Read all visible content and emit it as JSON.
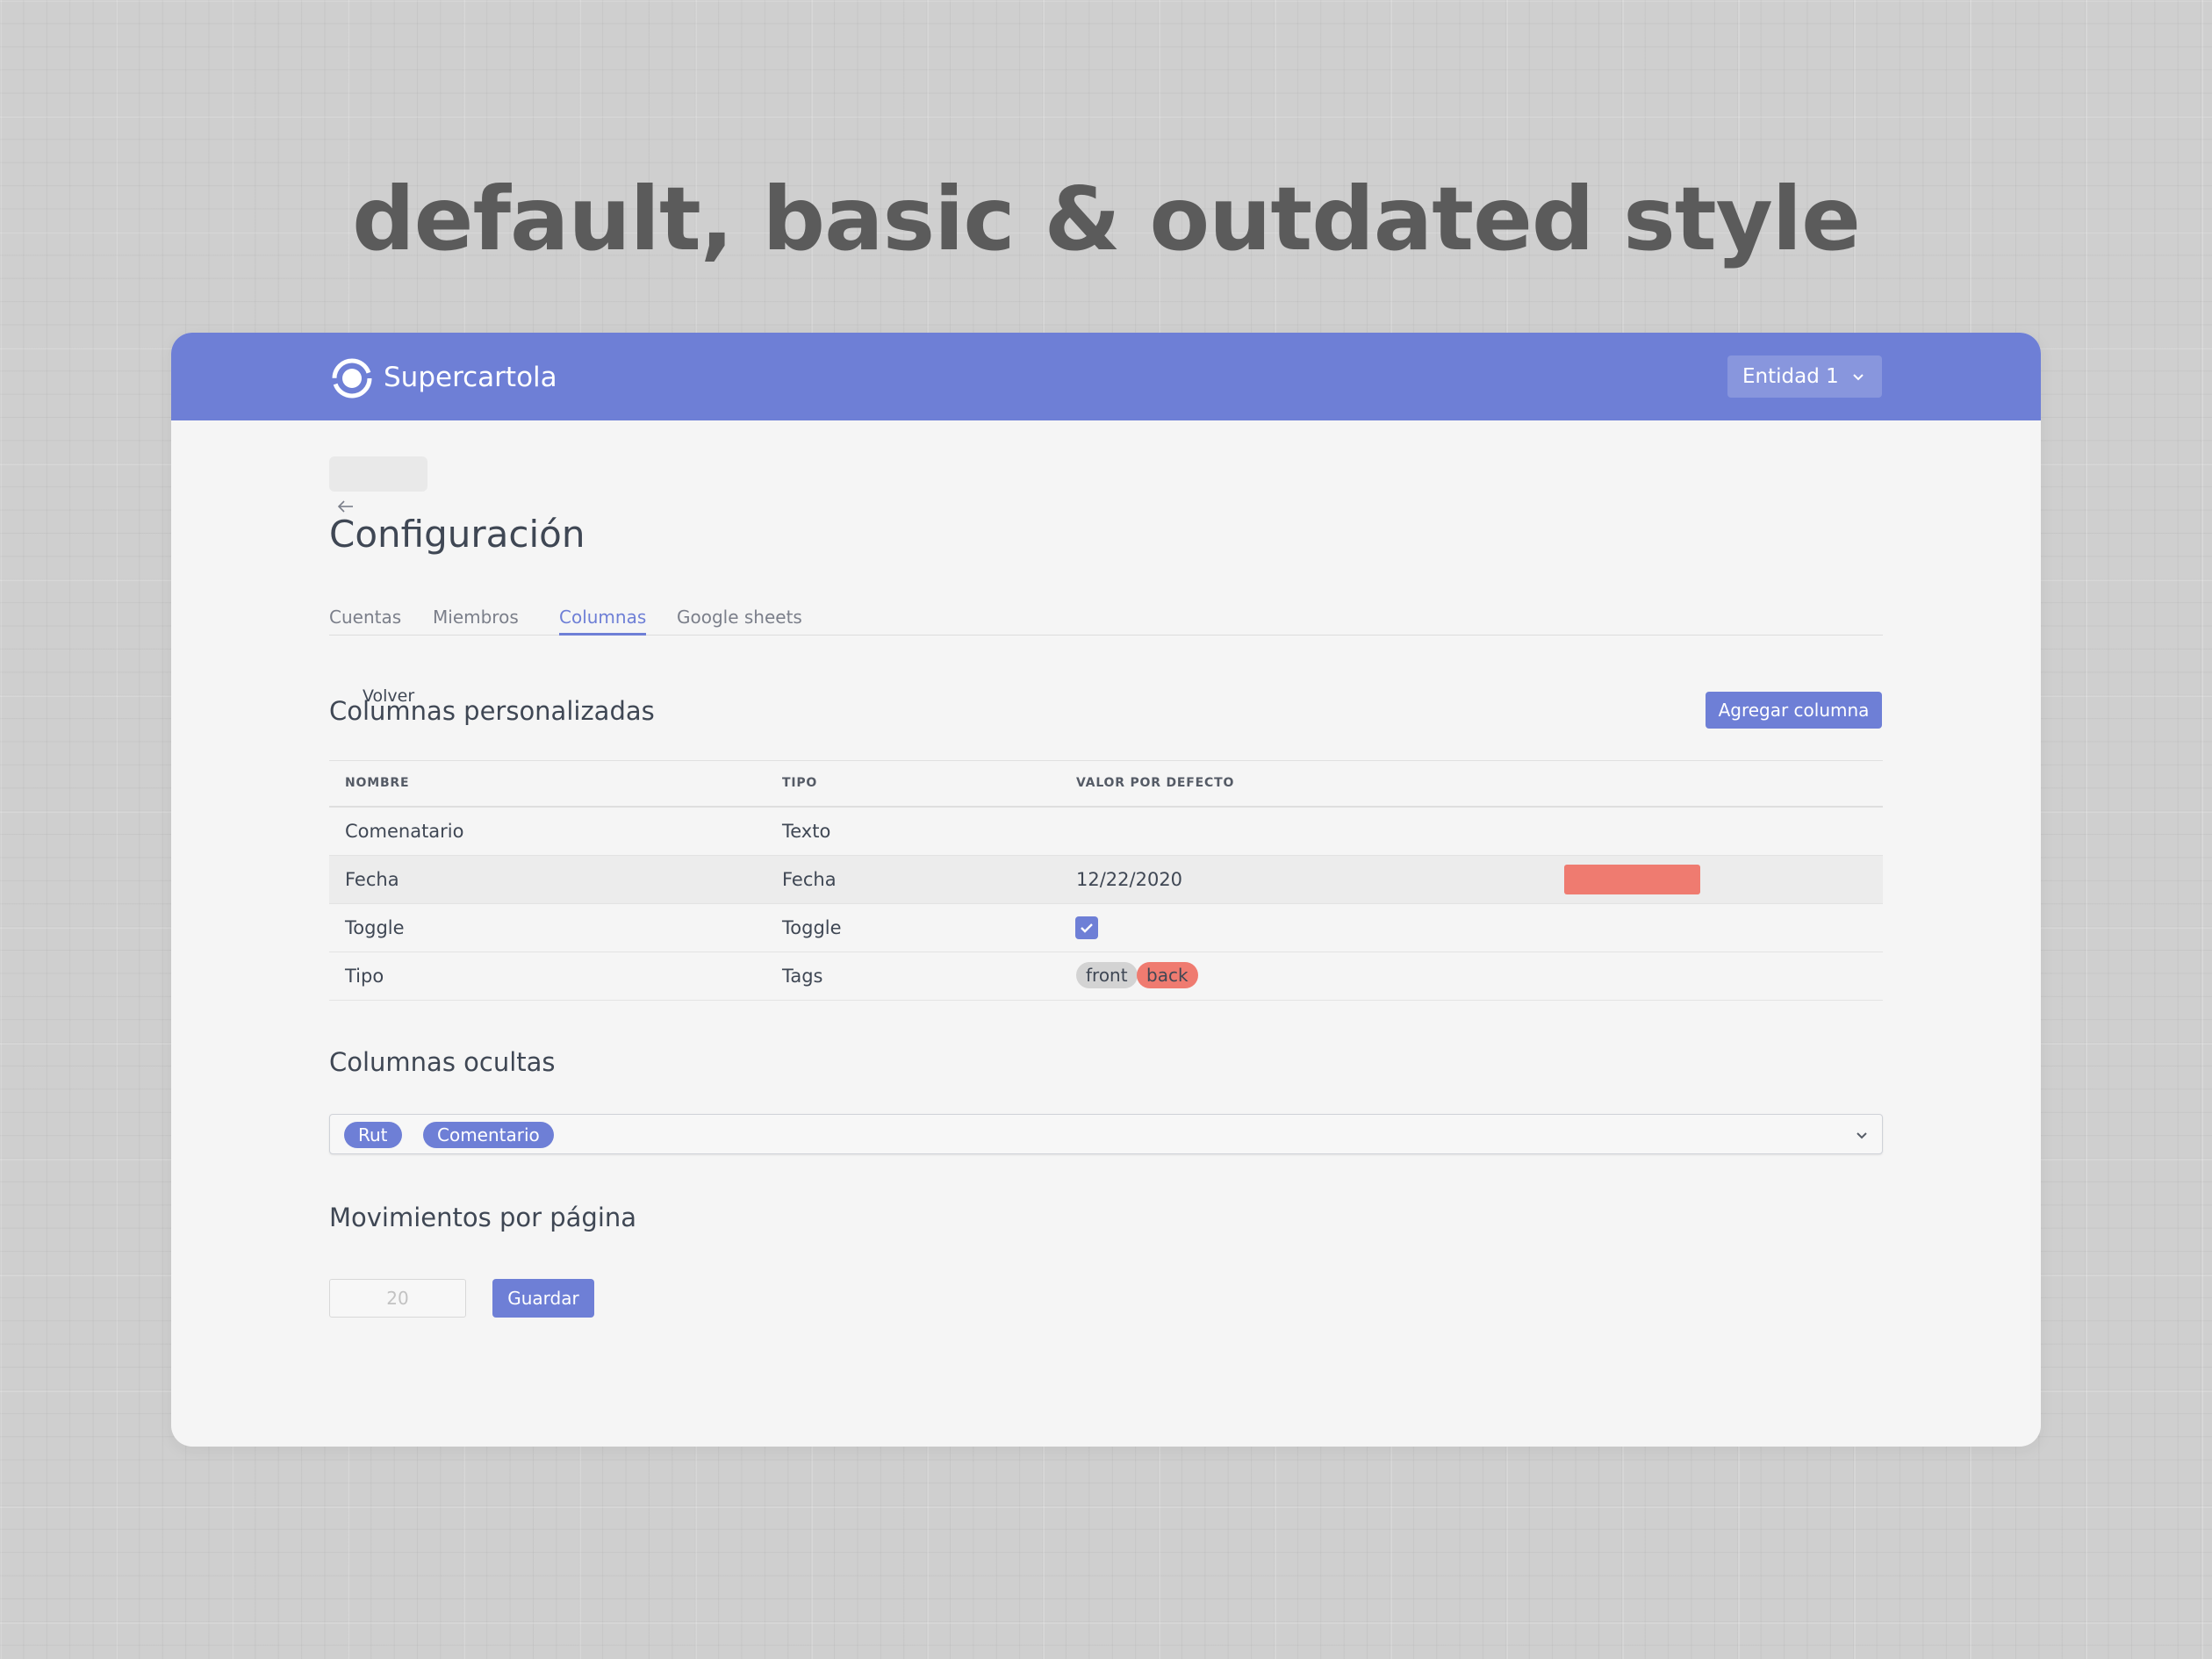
{
  "heading": "default, basic & outdated style",
  "app": {
    "brand": "Supercartola",
    "entity_selector": "Entidad 1",
    "accent_color": "#6e7fd6",
    "danger_color": "#ef7b70"
  },
  "page": {
    "back_label": "Volver",
    "title": "Configuración",
    "tabs": [
      {
        "label": "Cuentas",
        "active": false
      },
      {
        "label": "Miembros",
        "active": false
      },
      {
        "label": "Columnas",
        "active": true
      },
      {
        "label": "Google sheets",
        "active": false
      }
    ]
  },
  "custom_columns": {
    "title": "Columnas personalizadas",
    "add_button": "Agregar columna",
    "headers": [
      "NOMBRE",
      "TIPO",
      "VALOR POR DEFECTO"
    ],
    "rows": [
      {
        "name": "Comenatario",
        "type": "Texto",
        "default": ""
      },
      {
        "name": "Fecha",
        "type": "Fecha",
        "default": "12/22/2020"
      },
      {
        "name": "Toggle",
        "type": "Toggle",
        "default_checked": true
      },
      {
        "name": "Tipo",
        "type": "Tags",
        "tags": [
          "front",
          "back"
        ]
      }
    ]
  },
  "hidden_columns": {
    "title": "Columnas ocultas",
    "selected": [
      "Rut",
      "Comentario"
    ]
  },
  "per_page": {
    "title": "Movimientos por página",
    "placeholder": "20",
    "save_button": "Guardar"
  }
}
